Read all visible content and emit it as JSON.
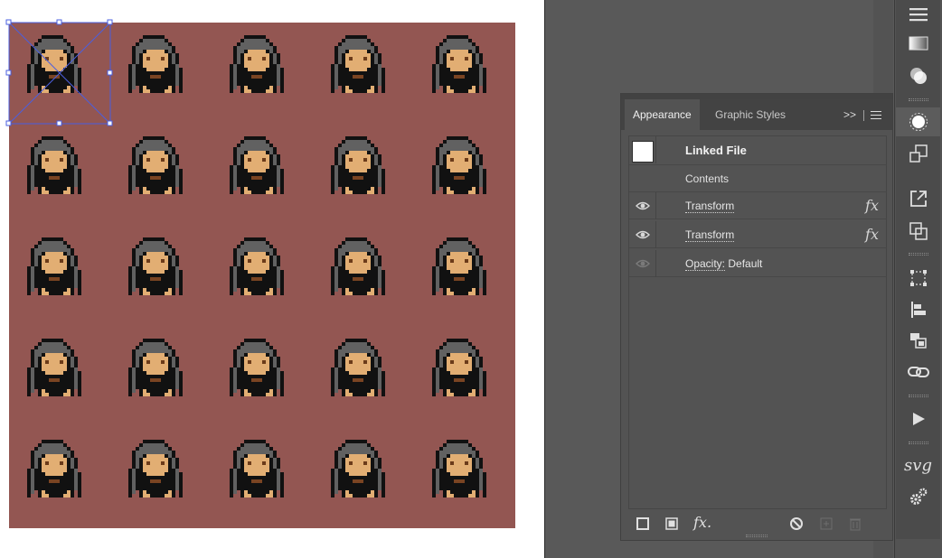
{
  "canvas": {
    "artboard_color": "#ffffff",
    "pattern_color": "#935652",
    "canvas_color": "#595959",
    "pattern_rows": 5,
    "pattern_cols": 5
  },
  "appearance_panel": {
    "tabs": [
      {
        "label": "Appearance",
        "active": true
      },
      {
        "label": "Graphic Styles",
        "active": false
      }
    ],
    "more_label": ">>",
    "rows": {
      "linked_file": {
        "label": "Linked File"
      },
      "contents": {
        "label": "Contents"
      },
      "transform_1": {
        "label": "Transform",
        "fx": "fx"
      },
      "transform_2": {
        "label": "Transform",
        "fx": "fx"
      },
      "opacity": {
        "label": "Opacity:",
        "value": "Default"
      }
    },
    "footer_fx_label": "fx."
  },
  "toolbar": {
    "items": [
      "hamburger-icon",
      "gradient-icon",
      "transparency-icon",
      "appearance-icon",
      "place-icon",
      "export-icon",
      "pathfinder-icon",
      "transform-icon",
      "align-icon",
      "arrange-icon",
      "links-icon",
      "play-icon",
      "svg-icon",
      "gears-icon"
    ],
    "svg_label": "svg"
  }
}
